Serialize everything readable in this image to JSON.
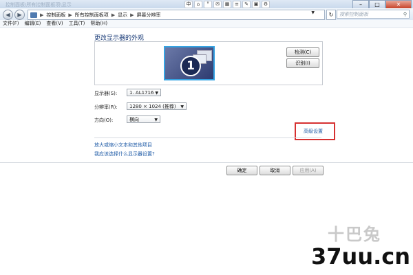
{
  "window": {
    "title": "控制面板\\所有控制面板项\\显示",
    "controls": {
      "minimize": "–",
      "maximize": "□",
      "close": "✕"
    }
  },
  "toolbar_glyphs": [
    "中",
    "⌂",
    "°",
    "✉",
    "▦",
    "≡",
    "✎",
    "▣",
    "⚙"
  ],
  "nav": {
    "back": "◀",
    "forward": "▶",
    "breadcrumbs": [
      "控制面板",
      "所有控制面板项",
      "显示",
      "屏幕分辨率"
    ],
    "separator": "▶",
    "search_placeholder": "搜索控制面板"
  },
  "menu": [
    "文件(F)",
    "编辑(E)",
    "查看(V)",
    "工具(T)",
    "帮助(H)"
  ],
  "main": {
    "heading": "更改显示器的外观",
    "monitor_number": "1",
    "detect_button": "检测(C)",
    "identify_button": "识别(I)",
    "display_label": "显示器(S):",
    "display_value": "1. AL1716",
    "resolution_label": "分辨率(R):",
    "resolution_value": "1280 × 1024 (推荐)",
    "orientation_label": "方向(O):",
    "orientation_value": "横向",
    "advanced_link": "高级设置",
    "link1": "放大或缩小文本和其他项目",
    "link2": "我应该选择什么显示器设置?"
  },
  "footer": {
    "ok": "确定",
    "cancel": "取消",
    "apply": "应用(A)"
  },
  "watermark": {
    "logo": "十巴兔",
    "site": "37uu.cn"
  },
  "colors": {
    "accent_link": "#1d5aa6",
    "highlight": "#d63030",
    "heading": "#1e3f7a"
  }
}
